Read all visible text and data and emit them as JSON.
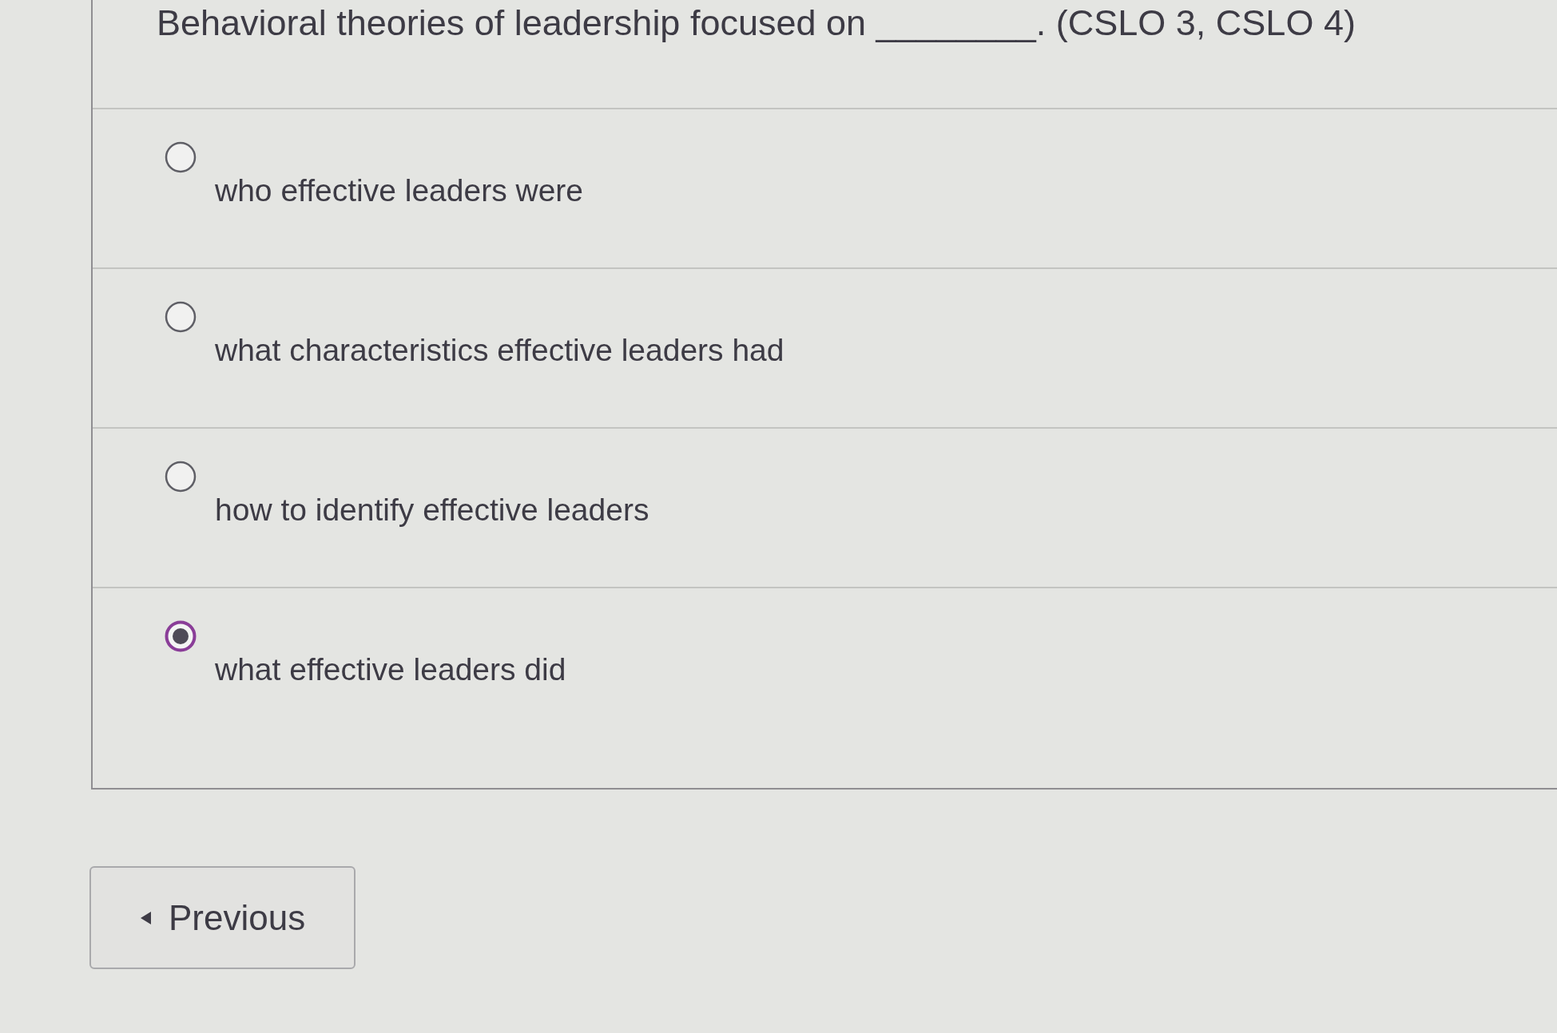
{
  "question": {
    "text": "Behavioral theories of leadership focused on ________. (CSLO 3, CSLO 4)"
  },
  "options": [
    {
      "label": "who effective leaders were",
      "selected": false
    },
    {
      "label": "what characteristics effective leaders had",
      "selected": false
    },
    {
      "label": "how to identify effective leaders",
      "selected": false
    },
    {
      "label": "what effective leaders did",
      "selected": true
    }
  ],
  "previous_button": {
    "label": "Previous"
  }
}
